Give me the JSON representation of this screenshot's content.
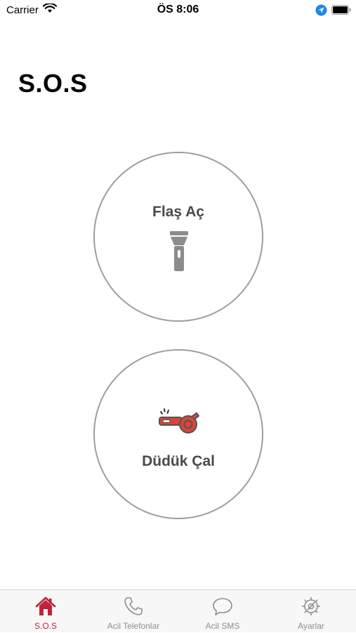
{
  "status_bar": {
    "carrier": "Carrier",
    "time": "ÖS 8:06"
  },
  "page": {
    "title": "S.O.S"
  },
  "actions": {
    "flash_label": "Flaş Aç",
    "whistle_label": "Düdük Çal"
  },
  "tabs": [
    {
      "label": "S.O.S",
      "icon": "home-icon",
      "active": true
    },
    {
      "label": "Acil Telefonlar",
      "icon": "phone-icon",
      "active": false
    },
    {
      "label": "Acil SMS",
      "icon": "chat-bubble-icon",
      "active": false
    },
    {
      "label": "Ayarlar",
      "icon": "gear-icon",
      "active": false
    }
  ],
  "colors": {
    "accent": "#c0223a",
    "inactive": "#8e8e8e",
    "whistle_red": "#d9453d"
  }
}
